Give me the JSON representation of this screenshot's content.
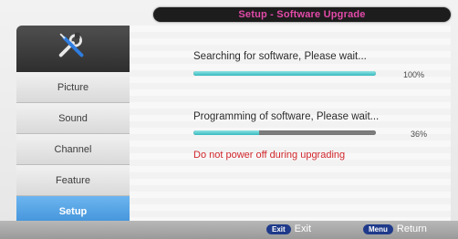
{
  "title": "Setup - Software Upgrade",
  "sidebar": {
    "items": [
      {
        "label": "Picture"
      },
      {
        "label": "Sound"
      },
      {
        "label": "Channel"
      },
      {
        "label": "Feature"
      },
      {
        "label": "Setup"
      }
    ],
    "active_index": 4,
    "header_icon": "tools-icon"
  },
  "main": {
    "search": {
      "label": "Searching for software, Please wait...",
      "progress_percent": 100,
      "percent_text": "100%"
    },
    "program": {
      "label": "Programming of software, Please wait...",
      "progress_percent": 36,
      "percent_text": "36%"
    },
    "warning": "Do not power off during upgrading"
  },
  "footer": {
    "exit_key": "Exit",
    "exit_label": "Exit",
    "menu_key": "Menu",
    "menu_label": "Return"
  },
  "colors": {
    "title_text": "#e24aa8",
    "active_tab": "#3d8fd6",
    "warning": "#d0262b",
    "progress": "#35b9be"
  }
}
